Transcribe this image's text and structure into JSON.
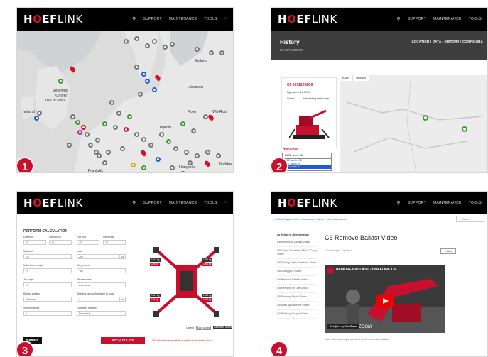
{
  "brand": {
    "pre": "H",
    "o": "O",
    "mid": "EF",
    "link": "LINK"
  },
  "nav": {
    "support": "SUPPORT",
    "maintenance": "MAINTENANCE",
    "tools": "TOOLS"
  },
  "badges": {
    "p1": "1",
    "p2": "2",
    "p3": "3",
    "p4": "4"
  },
  "panel1": {
    "labels": {
      "estland": "Estland",
      "verenigd": "Verenigd",
      "koninkr": "Koninkr",
      "isle": "Isle of Man",
      "ierland": "Ierland",
      "litouwen": "Litouwen",
      "polen": "Polen",
      "witrusl": "Wit-Rusl",
      "tsjechie": "Tsjechi",
      "frankrijk": "Frankrijk",
      "hongarije": "Hongarije",
      "moldav": "Moldav"
    }
  },
  "panel2": {
    "title": "History",
    "subtitle": "C6 20712002C6",
    "crumb": "LOCATION / DATA / HISTORY / CONFIGURA",
    "card_title": "C6 20712002C6",
    "card_line1": "Bijgewerkt 10:05:32",
    "card_status_label": "Status",
    "card_status": "Verbinding verbroken",
    "tab_map": "Kaart",
    "tab_sat": "Satelliet",
    "history_label": "HISTORIE",
    "select_value": "2022, week 33",
    "options": [
      "2022, week 172",
      "2022, week 35",
      "2022, week 33"
    ]
  },
  "panel3": {
    "title": "PERFORM CALCULATION",
    "fields": {
      "lf": "Left front",
      "rf": "Right front",
      "lr": "Left rear",
      "rr": "Right rear",
      "machine": "Machine",
      "load": "Load",
      "boom": "Main boom angle",
      "jib": "Jib present",
      "jibangle": "Jib angle",
      "jibext": "Jib extended",
      "ballast": "Ballast position",
      "radius": "Working radius (turntable to load)",
      "slew": "Slewing angle",
      "outrigger": "Outrigger position"
    },
    "values": {
      "lf": "45",
      "rf": "45",
      "lr": "45",
      "rr": "45",
      "machine": "C6",
      "load": "200",
      "load_unit": "kg",
      "boom": "70",
      "jib": "Yes",
      "jibangle": "70",
      "jibext": "Extended",
      "ballast": "Retracted",
      "radius": "1",
      "radius_unit": "m",
      "slew": "0",
      "outrigger": "Retracted"
    },
    "print": "PRINT",
    "recalc": "RECALCULATE",
    "legend": "Legend:",
    "legend_items": [
      "Max. values",
      "Calculated values"
    ],
    "weights": [
      "1647 kg",
      "195 kg",
      "1540 kg",
      "1166 kg",
      "1647 kg",
      "195 kg",
      "1540 kg",
      "1166 kg"
    ],
    "warning": "This calculation is indicative, no rights can be derived from it"
  },
  "panel4": {
    "crumb": "Hoeflink Support > User manuals and Videos > Video instructions",
    "search": "Search",
    "side_heading": "Articles in this section",
    "side_items": [
      "C6 Removing Ballast Video",
      "C6 Crane Functions Pick & Carry Video",
      "C6 Driving Track Positions Video",
      "C6 Outriggers Video",
      "C6 Remove Ballast Video",
      "C6 Remove Fly Jib Video",
      "C6 Steering Mode Video",
      "C6 Start up Machine Video",
      "C6 Working Support Bars"
    ],
    "title": "C6 Remove Ballast Video",
    "meta": "4 months ago · Updated",
    "follow": "Follow",
    "video_title": "REMOVE BALLAST - HOEFLINK C6",
    "watch_on": "Bekijken op",
    "youtube": "YouTube",
    "zoom": "ZOOM",
    "caption": "In the video above you can see how to remove the ballast."
  }
}
